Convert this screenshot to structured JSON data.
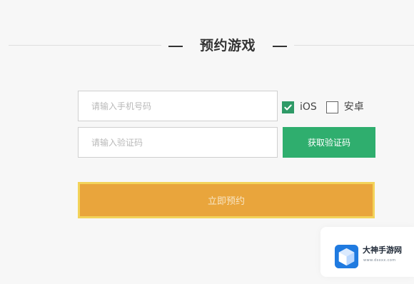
{
  "section": {
    "title": "预约游戏"
  },
  "form": {
    "phone_placeholder": "请输入手机号码",
    "code_placeholder": "请输入验证码",
    "get_code_label": "获取验证码",
    "submit_label": "立即预约",
    "platforms": [
      {
        "label": "iOS",
        "checked": true
      },
      {
        "label": "安卓",
        "checked": false
      }
    ]
  },
  "watermark": {
    "title": "大神手游网",
    "url": "www.dsxxx.com"
  },
  "colors": {
    "page_background": "#f7f7f7",
    "accent_green": "#2fae6e",
    "submit_orange": "#e9a53c",
    "submit_border": "#f3d35a",
    "logo_blue": "#1f7ae0"
  },
  "icons": {
    "checked_box": "check-icon",
    "logo": "cube-logo-icon"
  }
}
